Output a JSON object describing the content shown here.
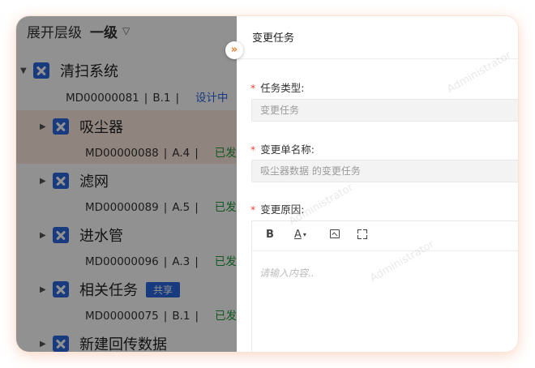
{
  "tree": {
    "expand_label": "展开层级",
    "level_value": "一级",
    "nodes": [
      {
        "name": "清扫系统",
        "code": "MD00000081",
        "version": "B.1",
        "status": "设计中",
        "share": ""
      },
      {
        "name": "吸尘器",
        "code": "MD00000088",
        "version": "A.4",
        "status": "已发布",
        "share": ""
      },
      {
        "name": "滤网",
        "code": "MD00000089",
        "version": "A.5",
        "status": "已发布",
        "share": ""
      },
      {
        "name": "进水管",
        "code": "MD00000096",
        "version": "A.3",
        "status": "已发布",
        "share": ""
      },
      {
        "name": "相关任务",
        "code": "MD00000075",
        "version": "B.1",
        "status": "已发布",
        "share": "共享"
      },
      {
        "name": "新建回传数据",
        "code": "",
        "version": "",
        "status": "",
        "share": ""
      }
    ]
  },
  "drawer": {
    "title": "变更任务",
    "collapse_glyph": "»",
    "fields": {
      "task_type": {
        "label": "任务类型:",
        "value": "变更任务"
      },
      "change_name": {
        "label": "变更单名称:",
        "value": "吸尘器数据 的变更任务"
      },
      "change_reason": {
        "label": "变更原因:",
        "placeholder": "请输入内容.."
      }
    },
    "toolbar": {
      "bold": "B",
      "font_color": "A",
      "caret": "▾"
    }
  },
  "watermark": "Administrator",
  "colors": {
    "accent_orange": "#f07a2a",
    "brand_blue": "#2b67e0",
    "status_green": "#1f9a38",
    "required_red": "#e6463c"
  }
}
